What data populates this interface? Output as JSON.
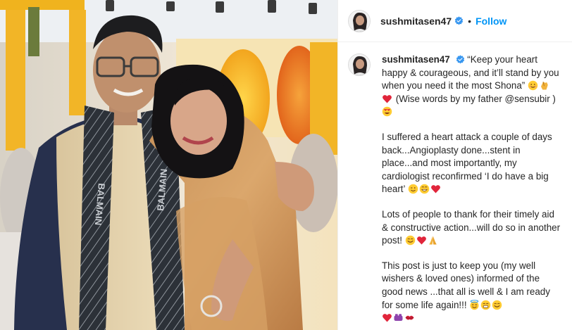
{
  "post": {
    "username": "sushmitasen47",
    "follow_label": "Follow",
    "separator": "•",
    "caption": {
      "line1_quote": "“Keep your heart happy & courageous, and it’ll stand by you when you need it the most Shona”",
      "line1_after": "(Wise words by my father @sensubir )",
      "para2": "I suffered a heart attack a couple of days back...Angioplasty done...stent in place...and most importantly, my cardiologist reconfirmed ‘I do have a big heart’",
      "para3": "Lots of people to thank for their timely aid & constructive action...will do so in another post!",
      "para4": "This post is just to keep you (my well wishers & loved ones) informed of the good news ...that all is well & I am ready for some life again!!!"
    },
    "scarf_text": "BALMAIN",
    "colors": {
      "follow": "#0095f6",
      "verified": "#3897f0",
      "text": "#262626"
    }
  }
}
